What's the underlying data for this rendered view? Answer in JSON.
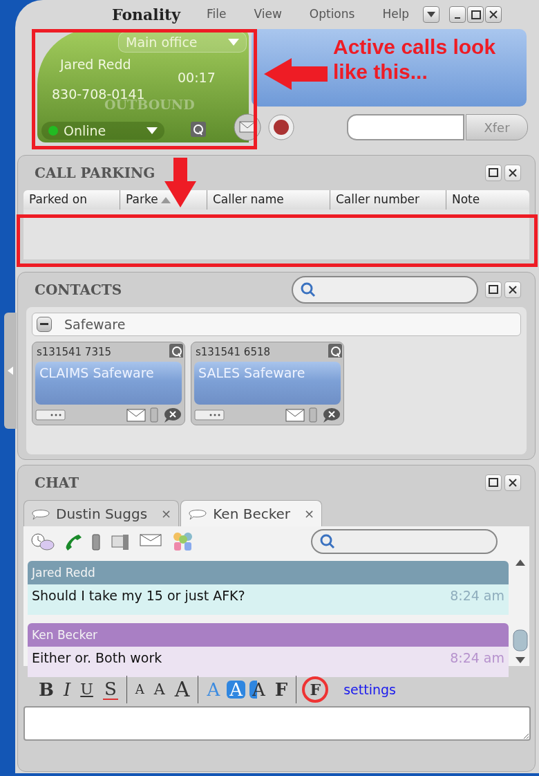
{
  "window": {
    "logo": "Fonality",
    "menu": [
      "File",
      "View",
      "Options",
      "Help"
    ]
  },
  "active_call": {
    "location": "Main office",
    "caller_name": "Jared Redd",
    "timer": "00:17",
    "caller_number": "830-708-0141",
    "direction": "OUTBOUND",
    "status": "Online",
    "status_online": true
  },
  "transfer": {
    "button": "Xfer"
  },
  "annotation": {
    "text": "Active calls look like this..."
  },
  "call_parking": {
    "title": "CALL PARKING",
    "columns": [
      "Parked on",
      "Parke",
      "Caller name",
      "Caller number",
      "Note"
    ]
  },
  "contacts": {
    "title": "CONTACTS",
    "group": {
      "name": "Safeware",
      "expanded": true
    },
    "cards": [
      {
        "extension": "s131541 7315",
        "name": "CLAIMS Safeware"
      },
      {
        "extension": "s131541 6518",
        "name": "SALES Safeware"
      }
    ]
  },
  "chat": {
    "title": "CHAT",
    "tabs": [
      {
        "label": "Dustin Suggs",
        "close": "×",
        "selected": false
      },
      {
        "label": "Ken Becker",
        "close": "×",
        "selected": true
      }
    ],
    "messages": [
      {
        "sender": "Jared Redd",
        "text": "Should I take my 15 or just AFK?",
        "time": "8:24 am",
        "color": "#7a9db0"
      },
      {
        "sender": "Ken Becker",
        "text": "Either or. Both work",
        "time": "8:24 am",
        "color": "#a97fc4"
      }
    ],
    "format_buttons": [
      {
        "kind": "bold",
        "label": "B"
      },
      {
        "kind": "italic",
        "label": "I"
      },
      {
        "kind": "underline",
        "label": "U"
      },
      {
        "kind": "strike",
        "label": "S"
      },
      {
        "kind": "sep"
      },
      {
        "kind": "smaller",
        "label": "A"
      },
      {
        "kind": "normal",
        "label": "A"
      },
      {
        "kind": "larger",
        "label": "A"
      },
      {
        "kind": "sep"
      },
      {
        "kind": "color",
        "label": "A"
      },
      {
        "kind": "highlight",
        "label": "A"
      },
      {
        "kind": "background",
        "label": "A"
      },
      {
        "kind": "font",
        "label": "F"
      },
      {
        "kind": "sep"
      },
      {
        "kind": "noformat",
        "label": "F"
      }
    ],
    "settings_link": "settings"
  }
}
